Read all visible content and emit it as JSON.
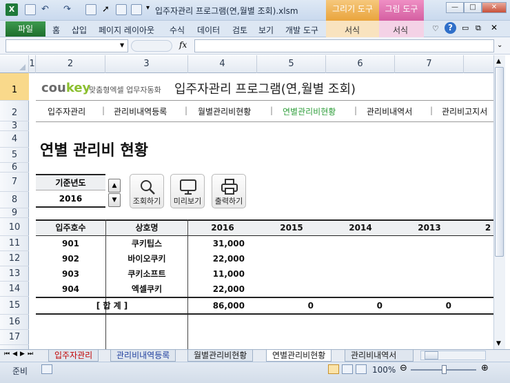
{
  "window": {
    "title": "입주자관리 프로그램(연,월별 조회).xlsm"
  },
  "context_tabs": {
    "drawing_tools": "그리기 도구",
    "picture_tools": "그림 도구"
  },
  "ribbon": {
    "file": "파일",
    "tabs": [
      "홈",
      "삽입",
      "페이지 레이아웃",
      "수식",
      "데이터",
      "검토",
      "보기",
      "개발 도구"
    ],
    "context_sub": [
      "서식",
      "서식"
    ]
  },
  "formula_bar": {
    "fx": "fx",
    "name_box": "",
    "value": ""
  },
  "columns": [
    "1",
    "2",
    "3",
    "4",
    "5",
    "6",
    "7"
  ],
  "rows": [
    "1",
    "2",
    "3",
    "4",
    "5",
    "6",
    "7",
    "8",
    "9",
    "10",
    "11",
    "12",
    "13",
    "14",
    "15",
    "16",
    "17"
  ],
  "brand": {
    "logo_co": "cou",
    "logo_key": "key",
    "tagline": "맞춤형엑셀 업무자동화"
  },
  "sheet_title": "입주자관리 프로그램(연,월별 조회)",
  "nav": [
    "입주자관리",
    "관리비내역등록",
    "월별관리비현황",
    "연별관리비현황",
    "관리비내역서",
    "관리비고지서"
  ],
  "page_heading": "연별 관리비 현황",
  "year_selector": {
    "label": "기준년도",
    "value": "2016"
  },
  "buttons": {
    "search": "조회하기",
    "preview": "미리보기",
    "print": "출력하기"
  },
  "table": {
    "headers": [
      "입주호수",
      "상호명",
      "2016",
      "2015",
      "2014",
      "2013",
      "2"
    ],
    "rows": [
      {
        "unit": "901",
        "name": "쿠키팁스",
        "y2016": "31,000"
      },
      {
        "unit": "902",
        "name": "바이오쿠키",
        "y2016": "22,000"
      },
      {
        "unit": "903",
        "name": "쿠키소프트",
        "y2016": "11,000"
      },
      {
        "unit": "904",
        "name": "엑셀쿠키",
        "y2016": "22,000"
      }
    ],
    "total": {
      "label": "[ 합   계 ]",
      "y2016": "86,000",
      "y2015": "0",
      "y2014": "0",
      "y2013": "0"
    }
  },
  "sheet_tabs": [
    "입주자관리",
    "관리비내역등록",
    "월별관리비현황",
    "연별관리비현황",
    "관리비내역서"
  ],
  "status": {
    "ready": "준비",
    "zoom": "100%"
  }
}
